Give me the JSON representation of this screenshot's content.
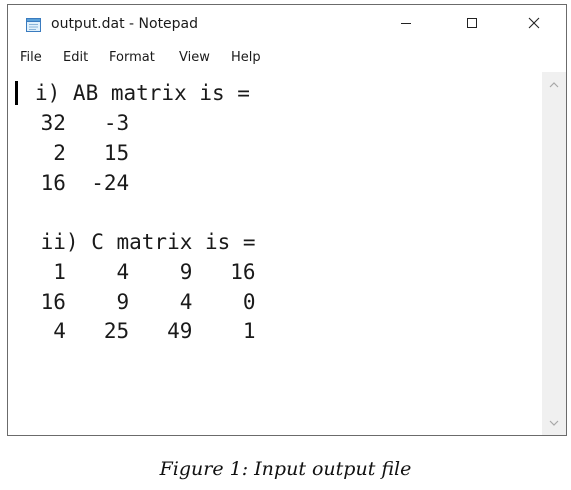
{
  "window": {
    "title": "output.dat - Notepad",
    "icon": "notepad-icon"
  },
  "window_controls": {
    "minimize": "minimize-icon",
    "maximize": "maximize-icon",
    "close": "close-icon"
  },
  "menubar": {
    "items": [
      {
        "label": "File"
      },
      {
        "label": "Edit"
      },
      {
        "label": "Format"
      },
      {
        "label": "View"
      },
      {
        "label": "Help"
      }
    ]
  },
  "editor": {
    "lines": [
      "i) AB matrix is =",
      " 32   -3",
      "  2   15",
      " 16  -24",
      "",
      " ii) C matrix is =",
      "  1    4    9   16",
      " 16    9    4    0",
      "  4   25   49    1"
    ]
  },
  "scrollbar": {
    "up": "scroll-up-arrow-icon",
    "down": "scroll-down-arrow-icon"
  },
  "caption": "Figure 1: Input output file"
}
